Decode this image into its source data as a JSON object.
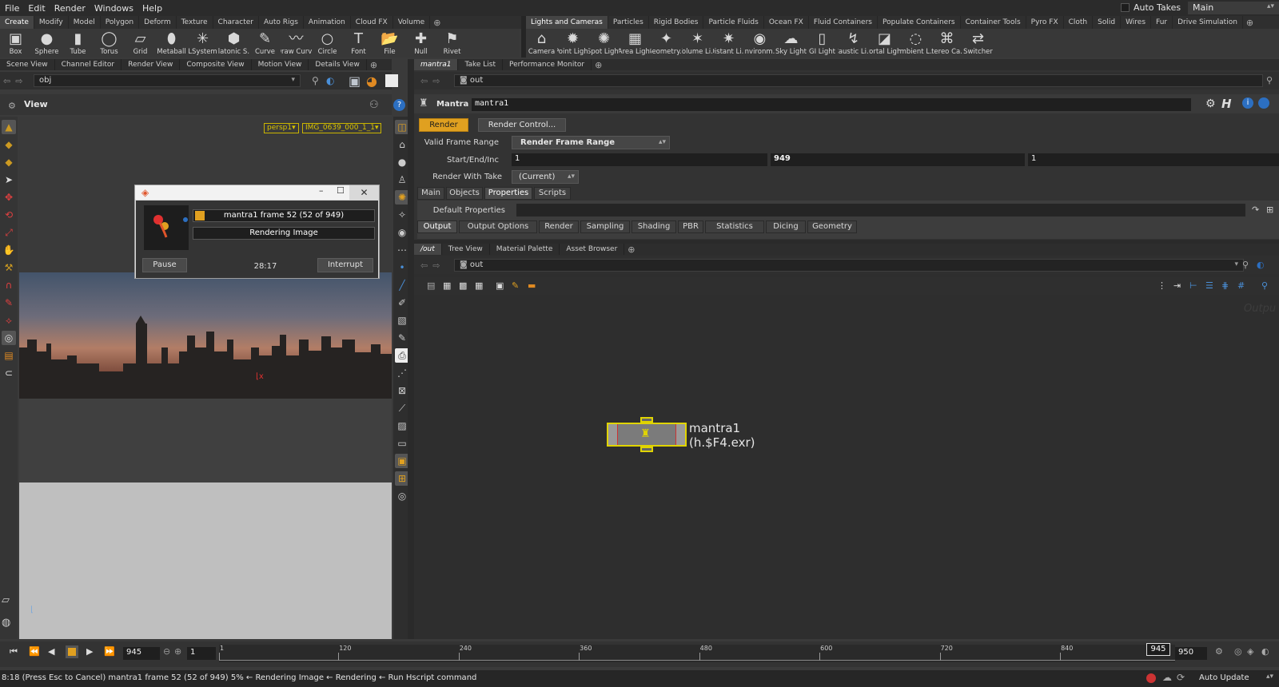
{
  "menubar": {
    "items": [
      "File",
      "Edit",
      "Render",
      "Windows",
      "Help"
    ],
    "auto_takes_label": "Auto Takes",
    "take_value": "Main"
  },
  "shelf_tabs_left": [
    "Create",
    "Modify",
    "Model",
    "Polygon",
    "Deform",
    "Texture",
    "Character",
    "Auto Rigs",
    "Animation",
    "Cloud FX",
    "Volume"
  ],
  "shelf_tabs_right": [
    "Lights and Cameras",
    "Particles",
    "Rigid Bodies",
    "Particle Fluids",
    "Ocean FX",
    "Fluid Containers",
    "Populate Containers",
    "Container Tools",
    "Pyro FX",
    "Cloth",
    "Solid",
    "Wires",
    "Fur",
    "Drive Simulation"
  ],
  "shelf_tools_left": [
    {
      "label": "Box",
      "icon": "box-icon",
      "glyph": "▣"
    },
    {
      "label": "Sphere",
      "icon": "sphere-icon",
      "glyph": "●"
    },
    {
      "label": "Tube",
      "icon": "tube-icon",
      "glyph": "▮"
    },
    {
      "label": "Torus",
      "icon": "torus-icon",
      "glyph": "◯"
    },
    {
      "label": "Grid",
      "icon": "grid-icon",
      "glyph": "▱"
    },
    {
      "label": "Metaball",
      "icon": "metaball-icon",
      "glyph": "⬮"
    },
    {
      "label": "LSystem",
      "icon": "lsystem-icon",
      "glyph": "✳"
    },
    {
      "label": "Platonic S...",
      "icon": "platonic-icon",
      "glyph": "⬢"
    },
    {
      "label": "Curve",
      "icon": "curve-icon",
      "glyph": "✎"
    },
    {
      "label": "Draw Curve",
      "icon": "draw-curve-icon",
      "glyph": "〰"
    },
    {
      "label": "Circle",
      "icon": "circle-icon",
      "glyph": "○"
    },
    {
      "label": "Font",
      "icon": "font-icon",
      "glyph": "T"
    },
    {
      "label": "File",
      "icon": "file-icon",
      "glyph": "📂"
    },
    {
      "label": "Null",
      "icon": "null-icon",
      "glyph": "✚"
    },
    {
      "label": "Rivet",
      "icon": "rivet-icon",
      "glyph": "⚑"
    }
  ],
  "shelf_tools_right": [
    {
      "label": "Camera",
      "icon": "camera-icon",
      "glyph": "⌂"
    },
    {
      "label": "Point Light",
      "icon": "point-light-icon",
      "glyph": "✹"
    },
    {
      "label": "Spot Light",
      "icon": "spot-light-icon",
      "glyph": "✺"
    },
    {
      "label": "Area Light",
      "icon": "area-light-icon",
      "glyph": "▦"
    },
    {
      "label": "Geometry...",
      "icon": "geometry-light-icon",
      "glyph": "✦"
    },
    {
      "label": "Volume Li...",
      "icon": "volume-light-icon",
      "glyph": "✶"
    },
    {
      "label": "Distant Li...",
      "icon": "distant-light-icon",
      "glyph": "✷"
    },
    {
      "label": "Environm...",
      "icon": "environment-light-icon",
      "glyph": "◉"
    },
    {
      "label": "Sky Light",
      "icon": "sky-light-icon",
      "glyph": "☁"
    },
    {
      "label": "GI Light",
      "icon": "gi-light-icon",
      "glyph": "▯"
    },
    {
      "label": "Caustic Li...",
      "icon": "caustic-light-icon",
      "glyph": "↯"
    },
    {
      "label": "Portal Light",
      "icon": "portal-light-icon",
      "glyph": "◪"
    },
    {
      "label": "Ambient L...",
      "icon": "ambient-light-icon",
      "glyph": "◌"
    },
    {
      "label": "Stereo Ca...",
      "icon": "stereo-camera-icon",
      "glyph": "⌘"
    },
    {
      "label": "Switcher",
      "icon": "switcher-icon",
      "glyph": "⇄"
    }
  ],
  "left_pane": {
    "tabs": [
      "Scene View",
      "Channel Editor",
      "Render View",
      "Composite View",
      "Motion View",
      "Details View"
    ],
    "path": "obj",
    "view_label": "View",
    "camera_menu": "persp1",
    "background_menu": "IMG_0639_000_1_1"
  },
  "render_dialog": {
    "frame_text": "mantra1 frame 52 (52 of 949)",
    "status_text": "Rendering Image",
    "pause_label": "Pause",
    "elapsed": "28:17",
    "interrupt_label": "Interrupt",
    "progress_fraction": 0.05
  },
  "params_pane": {
    "tabs": [
      "mantra1",
      "Take List",
      "Performance Monitor"
    ],
    "path": "out",
    "node_type": "Mantra",
    "node_name": "mantra1",
    "render_label": "Render",
    "render_control_label": "Render Control...",
    "valid_frame_range_label": "Valid Frame Range",
    "valid_frame_range_value": "Render Frame Range",
    "start_end_inc_label": "Start/End/Inc",
    "start": "1",
    "end": "949",
    "inc": "1",
    "render_with_take_label": "Render With Take",
    "render_with_take_value": "(Current)",
    "main_tabs": [
      "Main",
      "Objects",
      "Properties",
      "Scripts"
    ],
    "default_properties_label": "Default Properties",
    "sub_tabs": [
      "Output",
      "Output Options",
      "Render",
      "Sampling",
      "Shading",
      "PBR",
      "Statistics",
      "Dicing",
      "Geometry"
    ]
  },
  "network_pane": {
    "tabs": [
      "/out",
      "Tree View",
      "Material Palette",
      "Asset Browser"
    ],
    "path": "out",
    "watermark": "Outpu",
    "node_name": "mantra1",
    "node_output": "(h.$F4.exr)"
  },
  "timeline": {
    "current_frame": "945",
    "step": "1",
    "ticks": [
      "1",
      "120",
      "240",
      "360",
      "480",
      "600",
      "720",
      "840"
    ],
    "playhead": "945",
    "end_frame": "950"
  },
  "status": {
    "message": "8:18 (Press Esc to Cancel) mantra1 frame 52 (52 of 949) 5% ← Rendering Image ← Rendering ← Run Hscript command",
    "auto_update_label": "Auto Update"
  },
  "colors": {
    "accent": "#e0a020",
    "node_highlight": "#e0d400",
    "background": "#3a3a3a"
  }
}
